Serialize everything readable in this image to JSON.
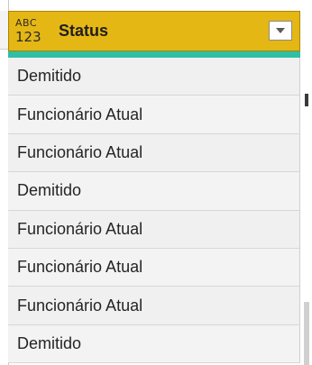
{
  "column": {
    "type_icon": {
      "top": "ABC",
      "bottom": "123",
      "name": "text-any-type-icon"
    },
    "title": "Status",
    "header_color": "#e5b715",
    "quality_bar_color": "#2ebfa5",
    "dropdown_icon": "chevron-down-icon"
  },
  "rows": [
    "Demitido",
    "Funcionário Atual",
    "Funcionário Atual",
    "Demitido",
    "Funcionário Atual",
    "Funcionário Atual",
    "Funcionário Atual",
    "Demitido"
  ]
}
